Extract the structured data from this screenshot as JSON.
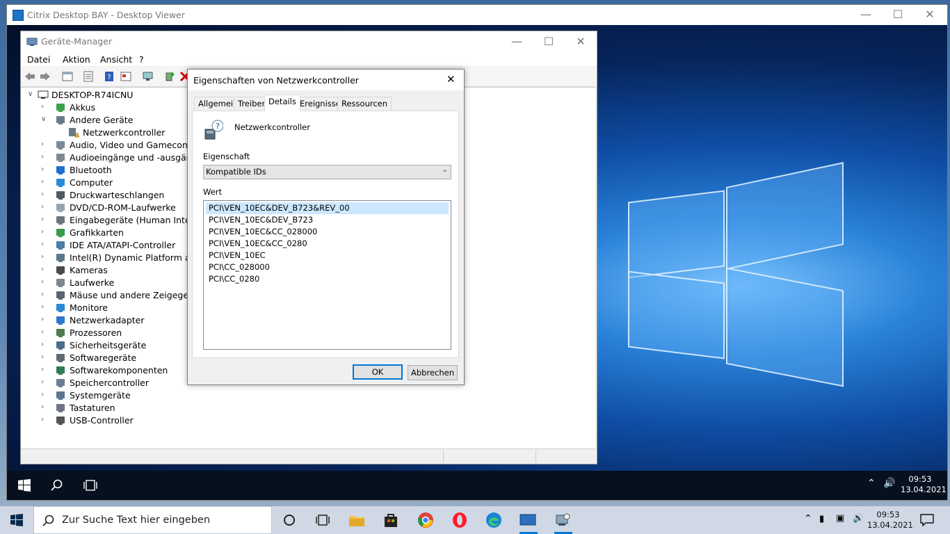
{
  "citrix": {
    "title": "Citrix Desktop BAY - Desktop Viewer"
  },
  "device_manager": {
    "title": "Geräte-Manager",
    "menu": [
      "Datei",
      "Aktion",
      "Ansicht",
      "?"
    ],
    "tree": [
      {
        "label": "DESKTOP-R74ICNU",
        "level": 0,
        "expander": "open"
      },
      {
        "label": "Akkus",
        "level": 1,
        "expander": "closed",
        "icon": "battery-icon"
      },
      {
        "label": "Andere Geräte",
        "level": 1,
        "expander": "open",
        "icon": "unknown-device-icon"
      },
      {
        "label": "Netzwerkcontroller",
        "level": 2,
        "expander": "none",
        "icon": "warning-device-icon"
      },
      {
        "label": "Audio, Video und Gamecontroller",
        "level": 1,
        "expander": "closed",
        "icon": "speaker-icon"
      },
      {
        "label": "Audioeingänge und -ausgänge",
        "level": 1,
        "expander": "closed",
        "icon": "speaker-icon"
      },
      {
        "label": "Bluetooth",
        "level": 1,
        "expander": "closed",
        "icon": "bluetooth-icon"
      },
      {
        "label": "Computer",
        "level": 1,
        "expander": "closed",
        "icon": "monitor-icon"
      },
      {
        "label": "Druckwarteschlangen",
        "level": 1,
        "expander": "closed",
        "icon": "printer-icon"
      },
      {
        "label": "DVD/CD-ROM-Laufwerke",
        "level": 1,
        "expander": "closed",
        "icon": "disc-icon"
      },
      {
        "label": "Eingabegeräte (Human Interface D",
        "level": 1,
        "expander": "closed",
        "icon": "keyboard-icon"
      },
      {
        "label": "Grafikkarten",
        "level": 1,
        "expander": "closed",
        "icon": "display-adapter-icon"
      },
      {
        "label": "IDE ATA/ATAPI-Controller",
        "level": 1,
        "expander": "closed",
        "icon": "controller-icon"
      },
      {
        "label": "Intel(R) Dynamic Platform and Th",
        "level": 1,
        "expander": "closed",
        "icon": "chip-icon"
      },
      {
        "label": "Kameras",
        "level": 1,
        "expander": "closed",
        "icon": "camera-icon"
      },
      {
        "label": "Laufwerke",
        "level": 1,
        "expander": "closed",
        "icon": "drive-icon"
      },
      {
        "label": "Mäuse und andere Zeigegeräte",
        "level": 1,
        "expander": "closed",
        "icon": "mouse-icon"
      },
      {
        "label": "Monitore",
        "level": 1,
        "expander": "closed",
        "icon": "monitor-icon"
      },
      {
        "label": "Netzwerkadapter",
        "level": 1,
        "expander": "closed",
        "icon": "network-icon"
      },
      {
        "label": "Prozessoren",
        "level": 1,
        "expander": "closed",
        "icon": "cpu-icon"
      },
      {
        "label": "Sicherheitsgeräte",
        "level": 1,
        "expander": "closed",
        "icon": "security-icon"
      },
      {
        "label": "Softwaregeräte",
        "level": 1,
        "expander": "closed",
        "icon": "device-icon"
      },
      {
        "label": "Softwarekomponenten",
        "level": 1,
        "expander": "closed",
        "icon": "component-icon"
      },
      {
        "label": "Speichercontroller",
        "level": 1,
        "expander": "closed",
        "icon": "storage-icon"
      },
      {
        "label": "Systemgeräte",
        "level": 1,
        "expander": "closed",
        "icon": "system-icon"
      },
      {
        "label": "Tastaturen",
        "level": 1,
        "expander": "closed",
        "icon": "keyboard-icon"
      },
      {
        "label": "USB-Controller",
        "level": 1,
        "expander": "closed",
        "icon": "usb-icon"
      }
    ]
  },
  "dialog": {
    "title": "Eigenschaften von Netzwerkcontroller",
    "close": "✕",
    "tabs": [
      "Allgemein",
      "Treiber",
      "Details",
      "Ereignisse",
      "Ressourcen"
    ],
    "active_tab": "Details",
    "device_name": "Netzwerkcontroller",
    "property_label": "Eigenschaft",
    "property_value": "Kompatible IDs",
    "value_label": "Wert",
    "values": [
      "PCI\\VEN_10EC&DEV_B723&REV_00",
      "PCI\\VEN_10EC&DEV_B723",
      "PCI\\VEN_10EC&CC_028000",
      "PCI\\VEN_10EC&CC_0280",
      "PCI\\VEN_10EC",
      "PCI\\CC_028000",
      "PCI\\CC_0280"
    ],
    "selected_value_index": 0,
    "ok_label": "OK",
    "cancel_label": "Abbrechen"
  },
  "remote_taskbar": {
    "time": "09:53",
    "date": "13.04.2021"
  },
  "host_taskbar": {
    "search_placeholder": "Zur Suche Text hier eingeben",
    "time": "09:53",
    "date": "13.04.2021"
  },
  "colors": {
    "accent": "#0078d7",
    "selection": "#cce8ff"
  }
}
